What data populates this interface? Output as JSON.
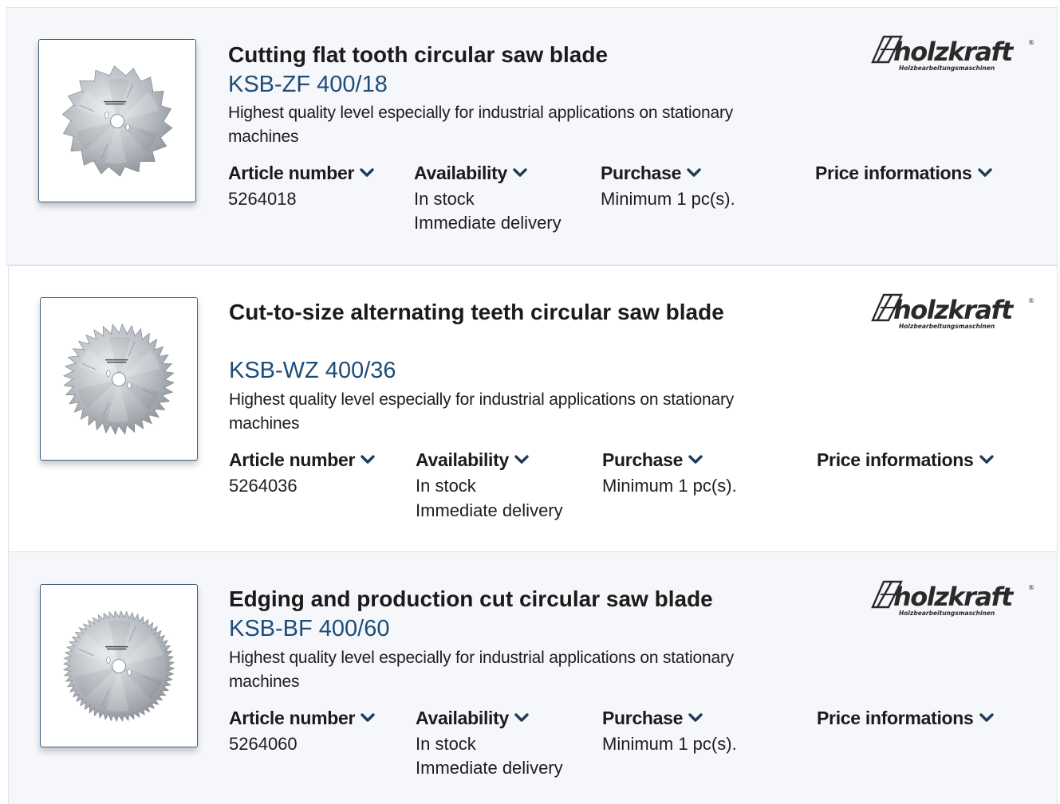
{
  "colors": {
    "accent": "#1e4d78",
    "chevron": "#1e3b5a",
    "card_highlight_bg": "#f5f7fa",
    "thumb_border": "#3b5f86"
  },
  "brand": {
    "name": "holzkraft",
    "tagline": "Holzbearbeitungsmaschinen",
    "icon": "holzkraft-logo-icon"
  },
  "labels": {
    "article_number": "Article number",
    "availability": "Availability",
    "purchase": "Purchase",
    "price_informations": "Price informations"
  },
  "products": [
    {
      "title": "Cutting flat tooth circular saw blade",
      "model": "KSB-ZF 400/18",
      "description": "Highest quality level especially for industrial applications on stationary machines",
      "article_number": "5264018",
      "availability_status": "In stock",
      "availability_delivery": "Immediate delivery",
      "purchase": "Minimum 1 pc(s)."
    },
    {
      "title": "Cut-to-size alternating teeth circular saw blade",
      "model": "KSB-WZ 400/36",
      "description": "Highest quality level especially for industrial applications on stationary machines",
      "article_number": "5264036",
      "availability_status": "In stock",
      "availability_delivery": "Immediate delivery",
      "purchase": "Minimum 1 pc(s)."
    },
    {
      "title": "Edging and production cut circular saw blade",
      "model": "KSB-BF 400/60",
      "description": "Highest quality level especially for industrial applications on stationary machines",
      "article_number": "5264060",
      "availability_status": "In stock",
      "availability_delivery": "Immediate delivery",
      "purchase": "Minimum 1 pc(s)."
    }
  ]
}
